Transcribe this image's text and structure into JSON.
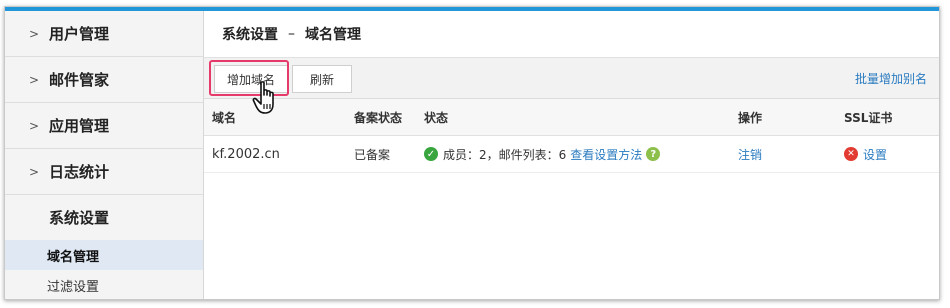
{
  "sidebar": {
    "items": [
      {
        "label": "用户管理"
      },
      {
        "label": "邮件管家"
      },
      {
        "label": "应用管理"
      },
      {
        "label": "日志统计"
      },
      {
        "label": "系统设置"
      }
    ],
    "sub_items": [
      {
        "label": "域名管理"
      },
      {
        "label": "过滤设置"
      }
    ]
  },
  "breadcrumb": {
    "parent": "系统设置",
    "separator": "–",
    "current": "域名管理"
  },
  "toolbar": {
    "add_label": "增加域名",
    "refresh_label": "刷新",
    "batch_alias_label": "批量增加别名"
  },
  "table": {
    "headers": {
      "domain": "域名",
      "beian": "备案状态",
      "status": "状态",
      "operation": "操作",
      "ssl": "SSL证书"
    },
    "rows": [
      {
        "domain": "kf.2002.cn",
        "beian": "已备案",
        "status_text": "成员：2，邮件列表：6",
        "status_link": "查看设置方法",
        "operation": "注销",
        "ssl": "设置"
      }
    ]
  },
  "icons": {
    "status_ok": "check-circle-icon",
    "help": "question-circle-icon",
    "ssl_error": "error-circle-icon",
    "cursor": "hand-pointer-icon"
  },
  "colors": {
    "accent": "#2196d9",
    "highlight": "#e63a6a",
    "link": "#2a7bc0",
    "ok": "#38a53f",
    "error": "#e23b32"
  }
}
